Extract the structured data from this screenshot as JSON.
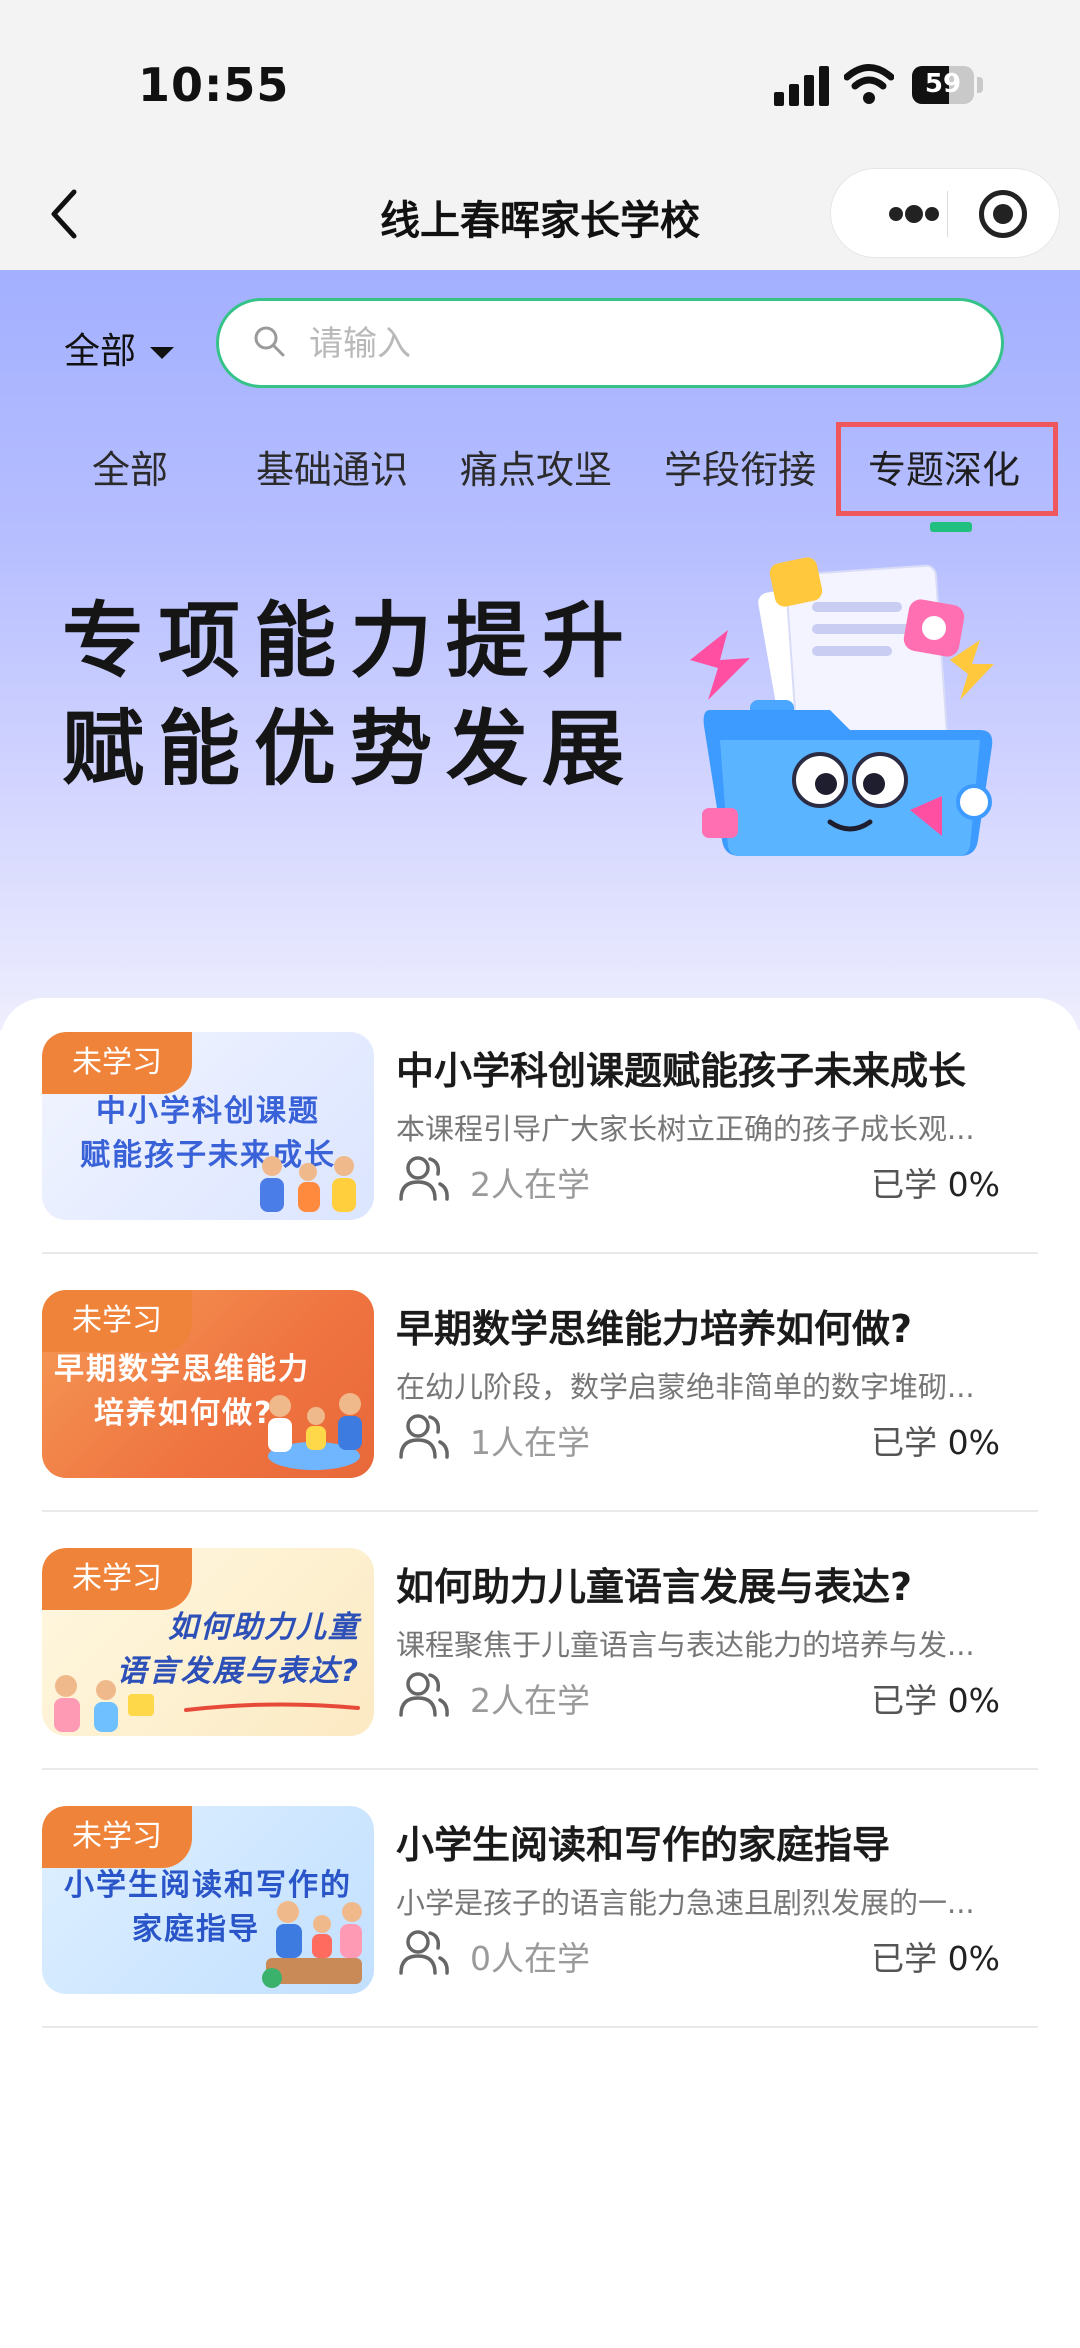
{
  "status_bar": {
    "time": "10:55",
    "battery": "59"
  },
  "nav": {
    "title": "线上春晖家长学校"
  },
  "filter": {
    "selected": "全部"
  },
  "search": {
    "placeholder": "请输入"
  },
  "tabs": [
    {
      "label": "全部"
    },
    {
      "label": "基础通识"
    },
    {
      "label": "痛点攻坚"
    },
    {
      "label": "学段衔接"
    },
    {
      "label": "专题深化"
    }
  ],
  "active_tab": 4,
  "banner": {
    "line1": "专项能力提升",
    "line2": "赋能优势发展"
  },
  "courses": [
    {
      "tag": "未学习",
      "thumb_line1": "中小学科创课题",
      "thumb_line2": "赋能孩子未来成长",
      "title": "中小学科创课题赋能孩子未来成长",
      "desc": "本课程引导广大家长树立正确的孩子成长观...",
      "learners": "2人在学",
      "progress_label": "已学",
      "progress_value": "0%"
    },
    {
      "tag": "未学习",
      "thumb_line1": "早期数学思维能力",
      "thumb_line2": "培养如何做?",
      "title": "早期数学思维能力培养如何做?",
      "desc": "在幼儿阶段，数学启蒙绝非简单的数字堆砌...",
      "learners": "1人在学",
      "progress_label": "已学",
      "progress_value": "0%"
    },
    {
      "tag": "未学习",
      "thumb_line1": "如何助力儿童",
      "thumb_line2": "语言发展与表达?",
      "title": "如何助力儿童语言发展与表达?",
      "desc": "课程聚焦于儿童语言与表达能力的培养与发...",
      "learners": "2人在学",
      "progress_label": "已学",
      "progress_value": "0%"
    },
    {
      "tag": "未学习",
      "thumb_line1": "小学生阅读和写作的",
      "thumb_line2": "家庭指导",
      "title": "小学生阅读和写作的家庭指导",
      "desc": "小学是孩子的语言能力急速且剧烈发展的一...",
      "learners": "0人在学",
      "progress_label": "已学",
      "progress_value": "0%"
    }
  ],
  "colors": {
    "accent_green": "#22c07e",
    "search_border": "#35c38a",
    "highlight_red": "#f0575c",
    "tag_orange": "#f0833a"
  }
}
